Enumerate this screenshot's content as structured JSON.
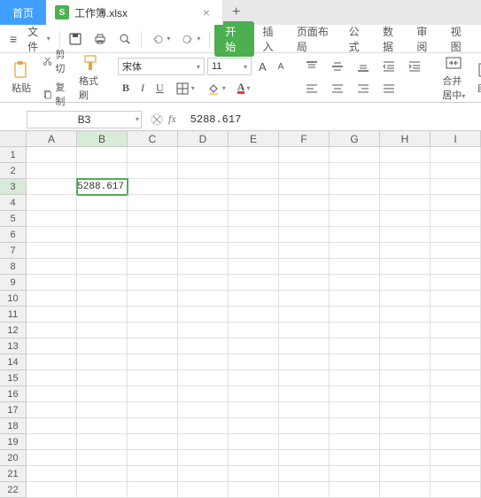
{
  "tabs": {
    "home": "首页",
    "file_icon": "S",
    "file_name": "工作簿.xlsx",
    "close": "×",
    "new": "+"
  },
  "menu": {
    "hamburger": "≡",
    "file": "文件",
    "start": "开始",
    "insert": "插入",
    "page_layout": "页面布局",
    "formula": "公式",
    "data": "数据",
    "review": "审阅",
    "view": "视图"
  },
  "ribbon": {
    "paste": "粘贴",
    "cut": "剪切",
    "copy": "复制",
    "format_painter": "格式刷",
    "font_name": "宋体",
    "font_size": "11",
    "bold": "B",
    "italic": "I",
    "underline": "U",
    "font_big": "A",
    "font_small": "A",
    "merge": "合并居中",
    "autowrap": "自动"
  },
  "formula_bar": {
    "cell_ref": "B3",
    "fx": "fx",
    "value": "5288.617"
  },
  "grid": {
    "columns": [
      "A",
      "B",
      "C",
      "D",
      "E",
      "F",
      "G",
      "H",
      "I"
    ],
    "rows": [
      "1",
      "2",
      "3",
      "4",
      "5",
      "6",
      "7",
      "8",
      "9",
      "10",
      "11",
      "12",
      "13",
      "14",
      "15",
      "16",
      "17",
      "18",
      "19",
      "20",
      "21",
      "22"
    ],
    "active_col": "B",
    "active_row": "3",
    "active_value": "5288.617"
  }
}
